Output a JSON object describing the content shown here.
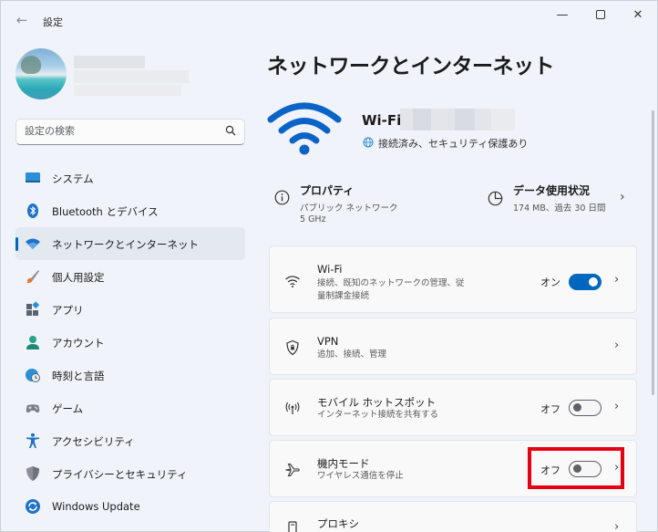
{
  "app": {
    "title": "設定"
  },
  "window_controls": {
    "minimize": "—",
    "maximize": "",
    "close": "✕"
  },
  "search": {
    "placeholder": "設定の検索"
  },
  "sidebar": {
    "items": [
      {
        "label": "システム",
        "icon": "system-icon"
      },
      {
        "label": "Bluetooth とデバイス",
        "icon": "bluetooth-icon"
      },
      {
        "label": "ネットワークとインターネット",
        "icon": "wifi-icon",
        "active": true
      },
      {
        "label": "個人用設定",
        "icon": "brush-icon"
      },
      {
        "label": "アプリ",
        "icon": "apps-icon"
      },
      {
        "label": "アカウント",
        "icon": "account-icon"
      },
      {
        "label": "時刻と言語",
        "icon": "clock-globe-icon"
      },
      {
        "label": "ゲーム",
        "icon": "gamepad-icon"
      },
      {
        "label": "アクセシビリティ",
        "icon": "accessibility-icon"
      },
      {
        "label": "プライバシーとセキュリティ",
        "icon": "shield-icon"
      },
      {
        "label": "Windows Update",
        "icon": "update-icon"
      }
    ]
  },
  "main": {
    "title": "ネットワークとインターネット",
    "hero": {
      "label": "Wi-Fi",
      "status": "接続済み、セキュリティ保護あり"
    },
    "properties": {
      "title": "プロパティ",
      "line1": "パブリック ネットワーク",
      "line2": "5 GHz"
    },
    "data_usage": {
      "title": "データ使用状況",
      "line1": "174 MB、過去 30 日間"
    },
    "cards": [
      {
        "title": "Wi-Fi",
        "sub": "接続、既知のネットワークの管理、従量制課金接続",
        "toggle_label": "オン",
        "toggle_on": true
      },
      {
        "title": "VPN",
        "sub": "追加、接続、管理"
      },
      {
        "title": "モバイル ホットスポット",
        "sub": "インターネット接続を共有する",
        "toggle_label": "オフ",
        "toggle_on": false
      },
      {
        "title": "機内モード",
        "sub": "ワイヤレス通信を停止",
        "toggle_label": "オフ",
        "toggle_on": false
      },
      {
        "title": "プロキシ",
        "sub": ""
      }
    ]
  },
  "colors": {
    "accent": "#0067c0",
    "highlight": "#e60012",
    "wifi_blue": "#0a64c8"
  }
}
